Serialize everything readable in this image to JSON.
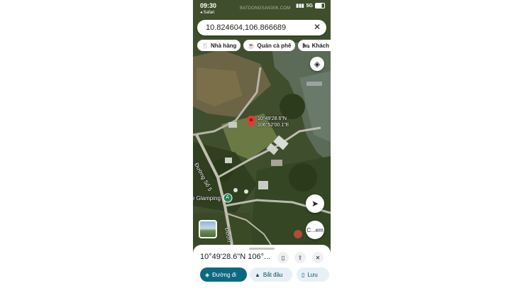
{
  "status": {
    "time": "09:30",
    "back_app": "◂ Safari",
    "network": "5G",
    "watermark": "BATDONGSAN30K.COM"
  },
  "search": {
    "value": "10.824604,106.866689",
    "clear_icon": "close-icon"
  },
  "chips": [
    {
      "icon": "restaurant-icon",
      "glyph": "🍴",
      "label": "Nhà hàng"
    },
    {
      "icon": "cafe-icon",
      "glyph": "☕",
      "label": "Quán cà phê"
    },
    {
      "icon": "hotel-icon",
      "glyph": "🛏",
      "label": "Khách s"
    }
  ],
  "map": {
    "pin_label_line1": "10°49'28.6\"N",
    "pin_label_line2": "106°52'00.1\"E",
    "road_label_1": "Đường Số 5",
    "road_label_2": "Đườn",
    "poi_label": "e Glamping",
    "poi_marker": "A",
    "lens_label": "C...em"
  },
  "sheet": {
    "title": "10°49'28.6\"N 106°...",
    "actions": {
      "directions": "Đường đi",
      "start": "Bắt đầu",
      "save": "Lưu"
    }
  },
  "colors": {
    "accent": "#0b6a80",
    "pin": "#e53935",
    "chip_bg": "#ffffff"
  }
}
